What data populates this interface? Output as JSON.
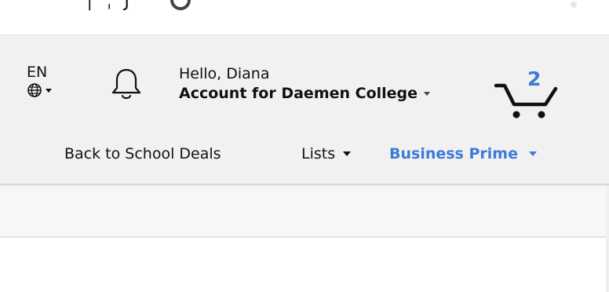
{
  "language": {
    "code": "EN",
    "icon": "globe-icon"
  },
  "notifications": {
    "icon": "bell-icon"
  },
  "account": {
    "greeting": "Hello, Diana",
    "name": "Account for Daemen College"
  },
  "cart": {
    "icon": "cart-icon",
    "count": "2"
  },
  "nav": {
    "back_to_school": "Back to School Deals",
    "lists": "Lists",
    "business_prime": "Business Prime"
  },
  "colors": {
    "header_bg": "#f2f1ef",
    "accent_blue": "#3b7bd9",
    "text": "#111111"
  }
}
